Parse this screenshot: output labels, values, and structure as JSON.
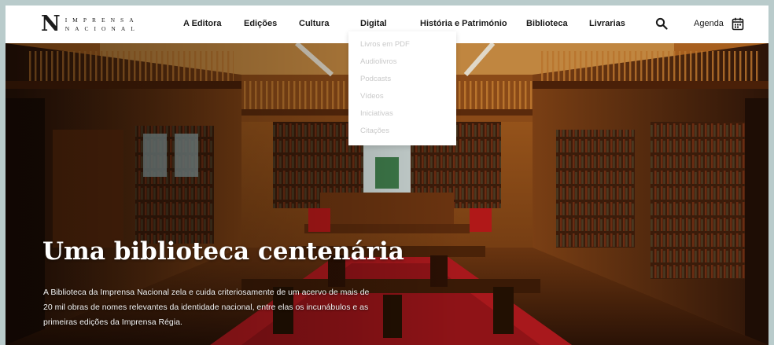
{
  "brand": {
    "mark": "N",
    "line1": "IMPRENSA",
    "line2": "NACIONAL"
  },
  "nav": {
    "items": [
      {
        "label": "A Editora"
      },
      {
        "label": "Edições"
      },
      {
        "label": "Cultura"
      },
      {
        "label": "Digital"
      },
      {
        "label": "História e Património"
      },
      {
        "label": "Biblioteca"
      },
      {
        "label": "Livrarias"
      }
    ],
    "search_icon": "search-icon",
    "agenda_label": "Agenda",
    "agenda_icon": "calendar-icon"
  },
  "dropdown": {
    "items": [
      {
        "label": "Livros em PDF"
      },
      {
        "label": "Audiolivros"
      },
      {
        "label": "Podcasts"
      },
      {
        "label": "Vídeos"
      },
      {
        "label": "Iniciativas"
      },
      {
        "label": "Citações"
      }
    ]
  },
  "hero": {
    "title": "Uma biblioteca centenária",
    "description": "A Biblioteca da Imprensa Nacional zela e cuida criteriosamente de um acervo de mais de 20 mil obras de nomes relevantes da identidade nacional, entre elas os incunábulos e as primeiras edições da Imprensa Régia."
  },
  "colors": {
    "page_border": "#b9cbcb",
    "header_bg": "#ffffff",
    "text_dark": "#1a1a1a",
    "dropdown_text": "#c9c9c9",
    "wood": "#7a3f14",
    "carpet": "#a8181c"
  }
}
